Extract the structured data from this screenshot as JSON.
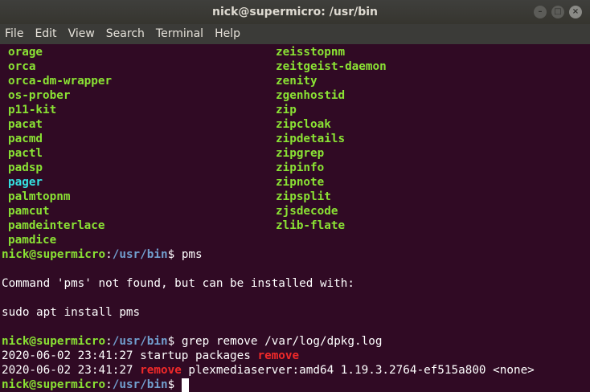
{
  "window": {
    "title": "nick@supermicro: /usr/bin",
    "controls": [
      "–",
      "□",
      "×"
    ]
  },
  "menu": [
    "File",
    "Edit",
    "View",
    "Search",
    "Terminal",
    "Help"
  ],
  "prompt": {
    "user": "nick@supermicro",
    "colon": ":",
    "path": "/usr/bin",
    "dollar": "$ "
  },
  "listing": {
    "col1": [
      "orage",
      "orca",
      "orca-dm-wrapper",
      "os-prober",
      "p11-kit",
      "pacat",
      "pacmd",
      "pactl",
      "padsp",
      "pager",
      "palmtopnm",
      "pamcut",
      "pamdeinterlace",
      "pamdice"
    ],
    "col2": [
      "zeisstopnm",
      "zeitgeist-daemon",
      "zenity",
      "zgenhostid",
      "zip",
      "zipcloak",
      "zipdetails",
      "zipgrep",
      "zipinfo",
      "zipnote",
      "zipsplit",
      "zjsdecode",
      "zlib-flate"
    ]
  },
  "session": {
    "cmd1": "pms",
    "not_found": "Command 'pms' not found, but can be installed with:",
    "install_hint": "sudo apt install pms",
    "cmd2": "grep remove /var/log/dpkg.log",
    "log1_prefix": "2020-06-02 23:41:27 startup packages ",
    "log1_match": "remove",
    "log2_prefix": "2020-06-02 23:41:27 ",
    "log2_match": "remove",
    "log2_suffix": " plexmediaserver:amd64 1.19.3.2764-ef515a800 <none>"
  }
}
